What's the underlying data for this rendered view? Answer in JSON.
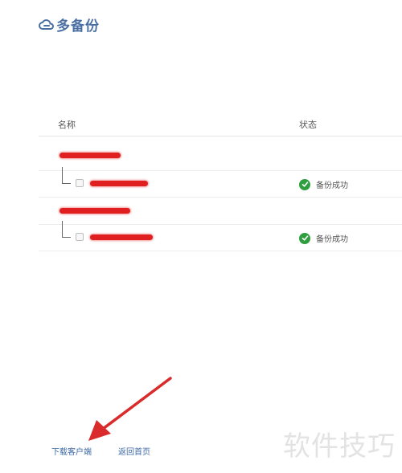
{
  "brand": {
    "name": "多备份",
    "color": "#4a6fa3"
  },
  "table": {
    "columns": {
      "name": "名称",
      "status": "状态"
    },
    "groups": [
      {
        "files": [
          {
            "status": "备份成功"
          }
        ]
      },
      {
        "files": [
          {
            "status": "备份成功"
          }
        ]
      }
    ]
  },
  "footer": {
    "download_client": "下载客户端",
    "back_home": "返回首页"
  },
  "watermark": "软件技巧",
  "colors": {
    "success": "#2e9e3f",
    "link": "#3d6aa3",
    "redaction": "#e02020",
    "annotation_arrow": "#d92b2b"
  }
}
